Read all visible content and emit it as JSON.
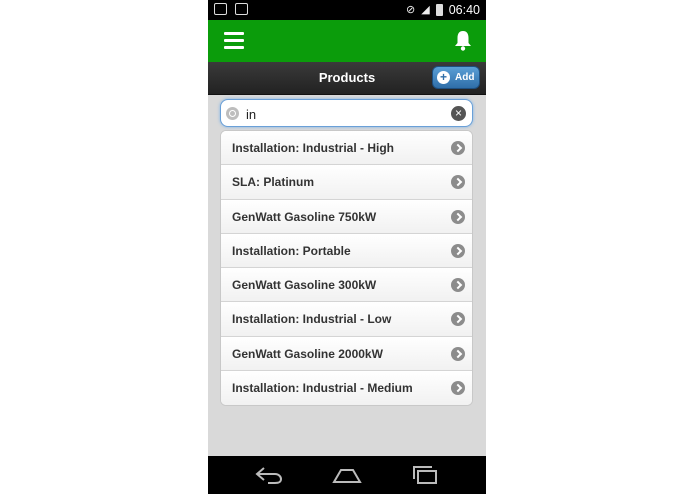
{
  "status_bar": {
    "time": "06:40",
    "left_icons": [
      "chat-icon",
      "image-icon"
    ],
    "right_icons": [
      "mute-icon",
      "signal-icon",
      "battery-icon"
    ]
  },
  "appbar": {
    "menu_icon": "hamburger-menu-icon",
    "bell_icon": "bell-icon",
    "color": "#0b9c0b"
  },
  "titlebar": {
    "title": "Products",
    "add_label": "Add"
  },
  "search": {
    "value": "in"
  },
  "products": [
    "Installation: Industrial - High",
    "SLA: Platinum",
    "GenWatt Gasoline 750kW",
    "Installation: Portable",
    "GenWatt Gasoline 300kW",
    "Installation: Industrial - Low",
    "GenWatt Gasoline 2000kW",
    "Installation: Industrial - Medium"
  ],
  "navbar": {
    "buttons": [
      "back-icon",
      "home-icon",
      "recent-apps-icon"
    ]
  }
}
